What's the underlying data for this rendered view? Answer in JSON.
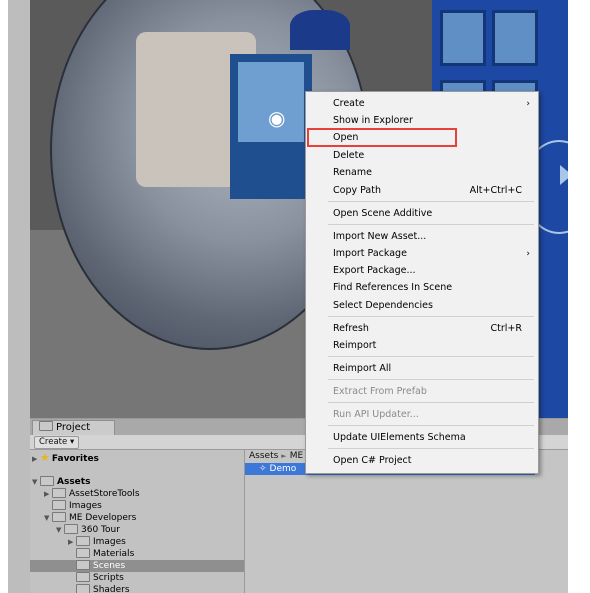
{
  "context_menu": {
    "create": "Create",
    "show_in_explorer": "Show in Explorer",
    "open": "Open",
    "delete": "Delete",
    "rename": "Rename",
    "copy_path": "Copy Path",
    "copy_path_shortcut": "Alt+Ctrl+C",
    "open_scene_additive": "Open Scene Additive",
    "import_new_asset": "Import New Asset...",
    "import_package": "Import Package",
    "export_package": "Export Package...",
    "find_references": "Find References In Scene",
    "select_dependencies": "Select Dependencies",
    "refresh": "Refresh",
    "refresh_shortcut": "Ctrl+R",
    "reimport": "Reimport",
    "reimport_all": "Reimport All",
    "extract_from_prefab": "Extract From Prefab",
    "run_api_updater": "Run API Updater...",
    "update_ui_schema": "Update UIElements Schema",
    "open_csharp_project": "Open C# Project"
  },
  "project_panel": {
    "tab_label": "Project",
    "create_button": "Create ▾",
    "tree": {
      "favorites": "Favorites",
      "assets": "Assets",
      "asset_store_tools": "AssetStoreTools",
      "images": "Images",
      "me_developers": "ME Developers",
      "tour_360": "360 Tour",
      "tour_images": "Images",
      "materials": "Materials",
      "scenes": "Scenes",
      "scripts": "Scripts",
      "shaders": "Shaders"
    },
    "breadcrumb": {
      "root": "Assets",
      "current": "ME"
    },
    "selected_file": "Demo"
  },
  "colors": {
    "highlight_box": "#e8403a",
    "selection_blue": "#3d78d8"
  }
}
